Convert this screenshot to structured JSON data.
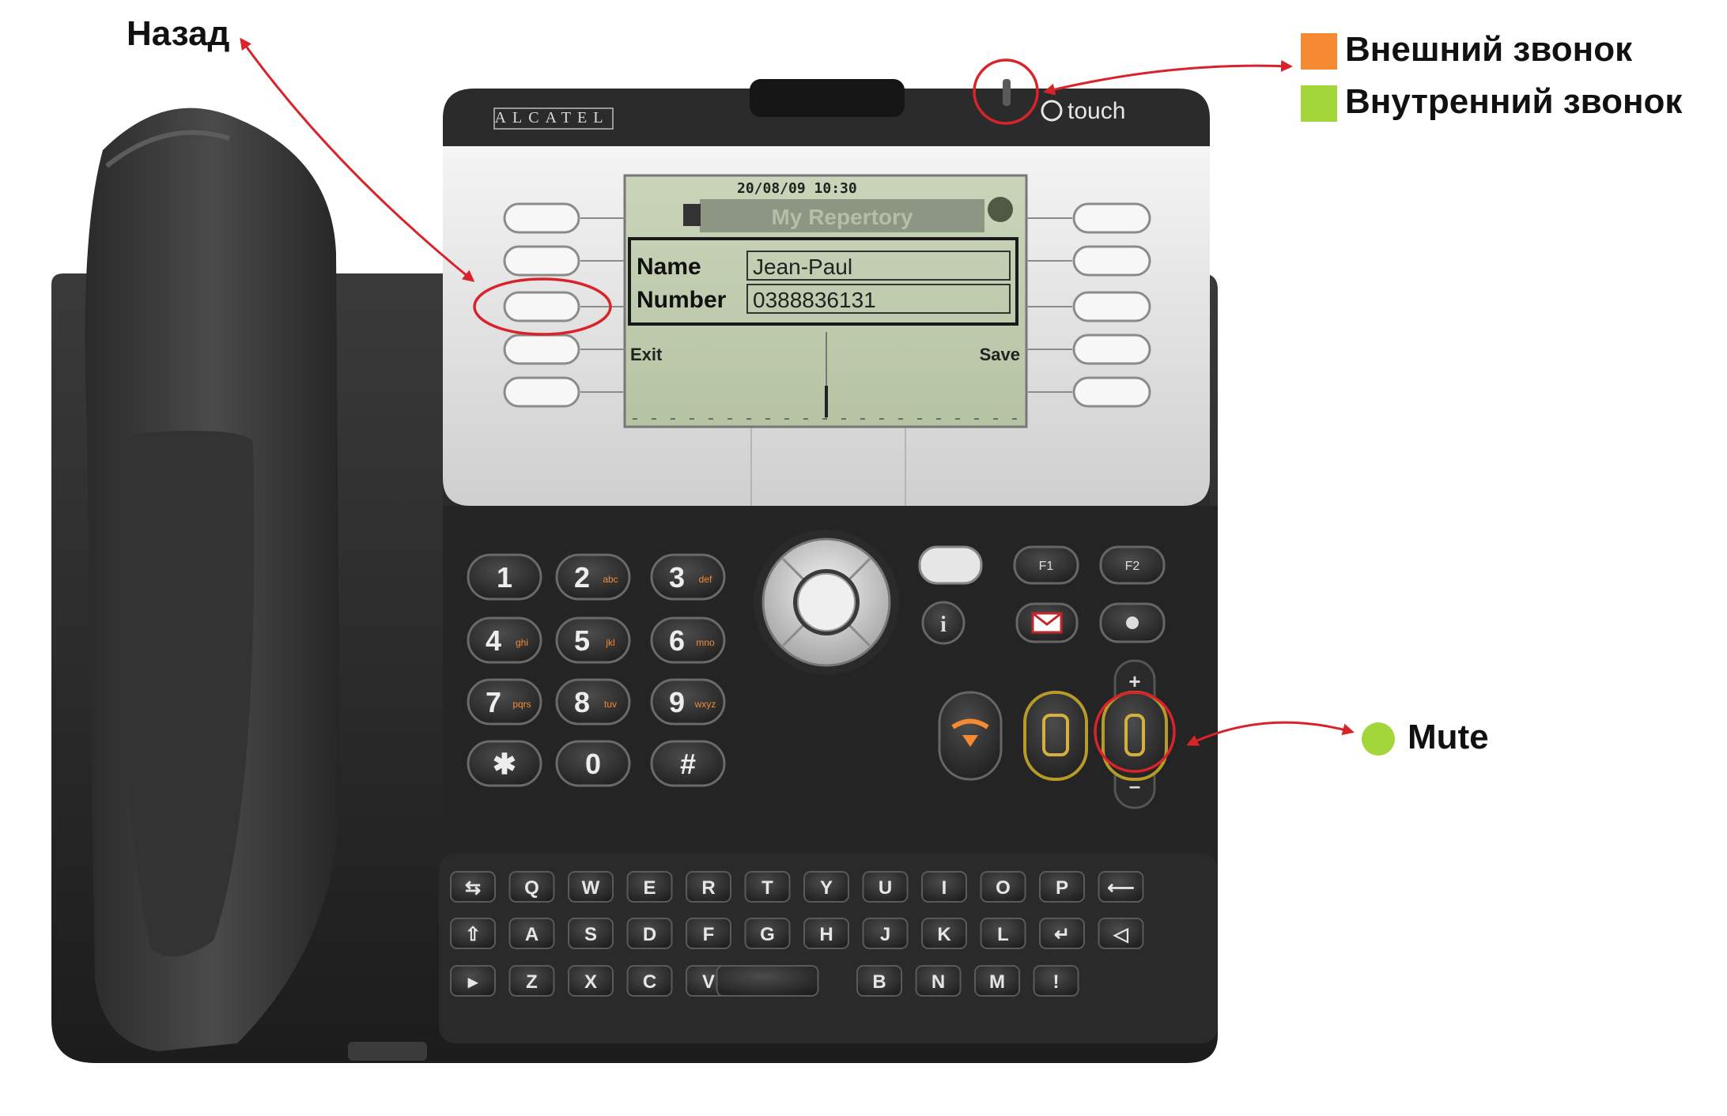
{
  "annotations": {
    "back": "Назад",
    "external_ring": "Внешний звонок",
    "internal_ring": "Внутренний звонок",
    "mute": "Mute"
  },
  "legend_colors": {
    "external": "#f58a32",
    "internal": "#a3d63a",
    "mute_dot": "#a3d63a",
    "annotation_red": "#d9232b"
  },
  "phone": {
    "brand": "ALCATEL",
    "model_label": "touch",
    "screen": {
      "status_line": "20/08/09 10:30",
      "title": "My Repertory",
      "name_label": "Name",
      "name_value": "Jean-Paul",
      "number_label": "Number",
      "number_value": "0388836131",
      "left_softkey": "Exit",
      "right_softkey": "Save"
    },
    "keypad": [
      [
        "1",
        ""
      ],
      [
        "2",
        "abc"
      ],
      [
        "3",
        "def"
      ],
      [
        "4",
        "ghi"
      ],
      [
        "5",
        "jkl"
      ],
      [
        "6",
        "mno"
      ],
      [
        "7",
        "pqrs"
      ],
      [
        "8",
        "tuv"
      ],
      [
        "9",
        "wxyz"
      ],
      [
        "✱",
        ""
      ],
      [
        "0",
        ""
      ],
      [
        "#",
        ""
      ]
    ],
    "function_keys": {
      "f1": "F1",
      "f2": "F2",
      "info": "i",
      "plus": "+",
      "minus": "–"
    },
    "alpha_rows": [
      [
        "⇆",
        "Q",
        "W",
        "E",
        "R",
        "T",
        "Y",
        "U",
        "I",
        "O",
        "P",
        "⟵"
      ],
      [
        "⇧",
        "A",
        "S",
        "D",
        "F",
        "G",
        "H",
        "J",
        "K",
        "L",
        "↵",
        "◁"
      ],
      [
        "▸",
        "Z",
        "X",
        "C",
        "V",
        "",
        "B",
        "N",
        "M",
        "!"
      ]
    ]
  }
}
